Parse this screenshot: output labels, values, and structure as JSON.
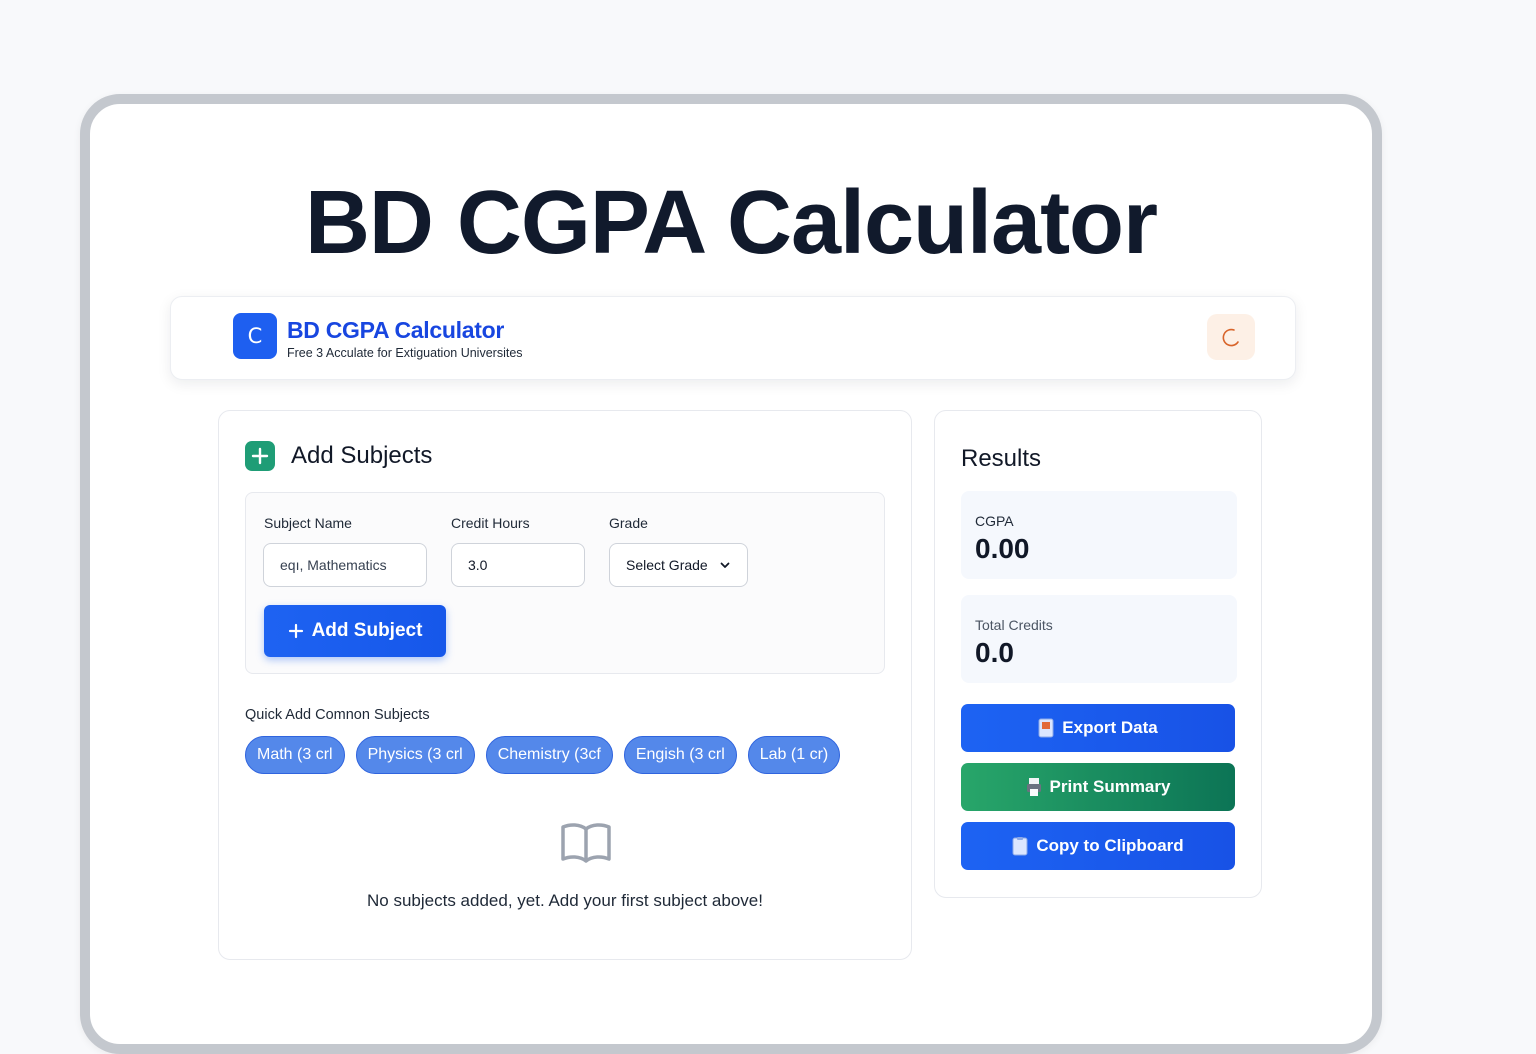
{
  "hero": {
    "title": "BD CGPA Calculator"
  },
  "header": {
    "logo_letter": "C",
    "title": "BD CGPA Calculator",
    "subtitle": "Free 3 Acculate for Extiguation Universites"
  },
  "subjects": {
    "title": "Add Subjects",
    "form": {
      "subject_name_label": "Subject Name",
      "subject_name_placeholder": "eqı, Mathematics",
      "credit_hours_label": "Credit Hours",
      "credit_hours_value": "3.0",
      "grade_label": "Grade",
      "grade_selected": "Select Grade",
      "add_button": "Add Subject"
    },
    "quick_add_label": "Quick Add Comnon Subjects",
    "quick_add": [
      "Math (3 crl",
      "Physics (3 crl",
      "Chemistry (3cf",
      "Engish (3 crl",
      "Lab (1 cr)"
    ],
    "empty_message": "No subjects added, yet. Add your first subject above!"
  },
  "results": {
    "title": "Results",
    "cgpa_label": "CGPA",
    "cgpa_value": "0.00",
    "credits_label": "Total Credits",
    "credits_value": "0.0",
    "export_button": "Export Data",
    "print_button": "Print Summary",
    "copy_button": "Copy to Clipboard"
  },
  "colors": {
    "primary": "#1e5ff0",
    "success": "#1f9d76",
    "chip": "#5488ea",
    "title": "#111a2c"
  }
}
